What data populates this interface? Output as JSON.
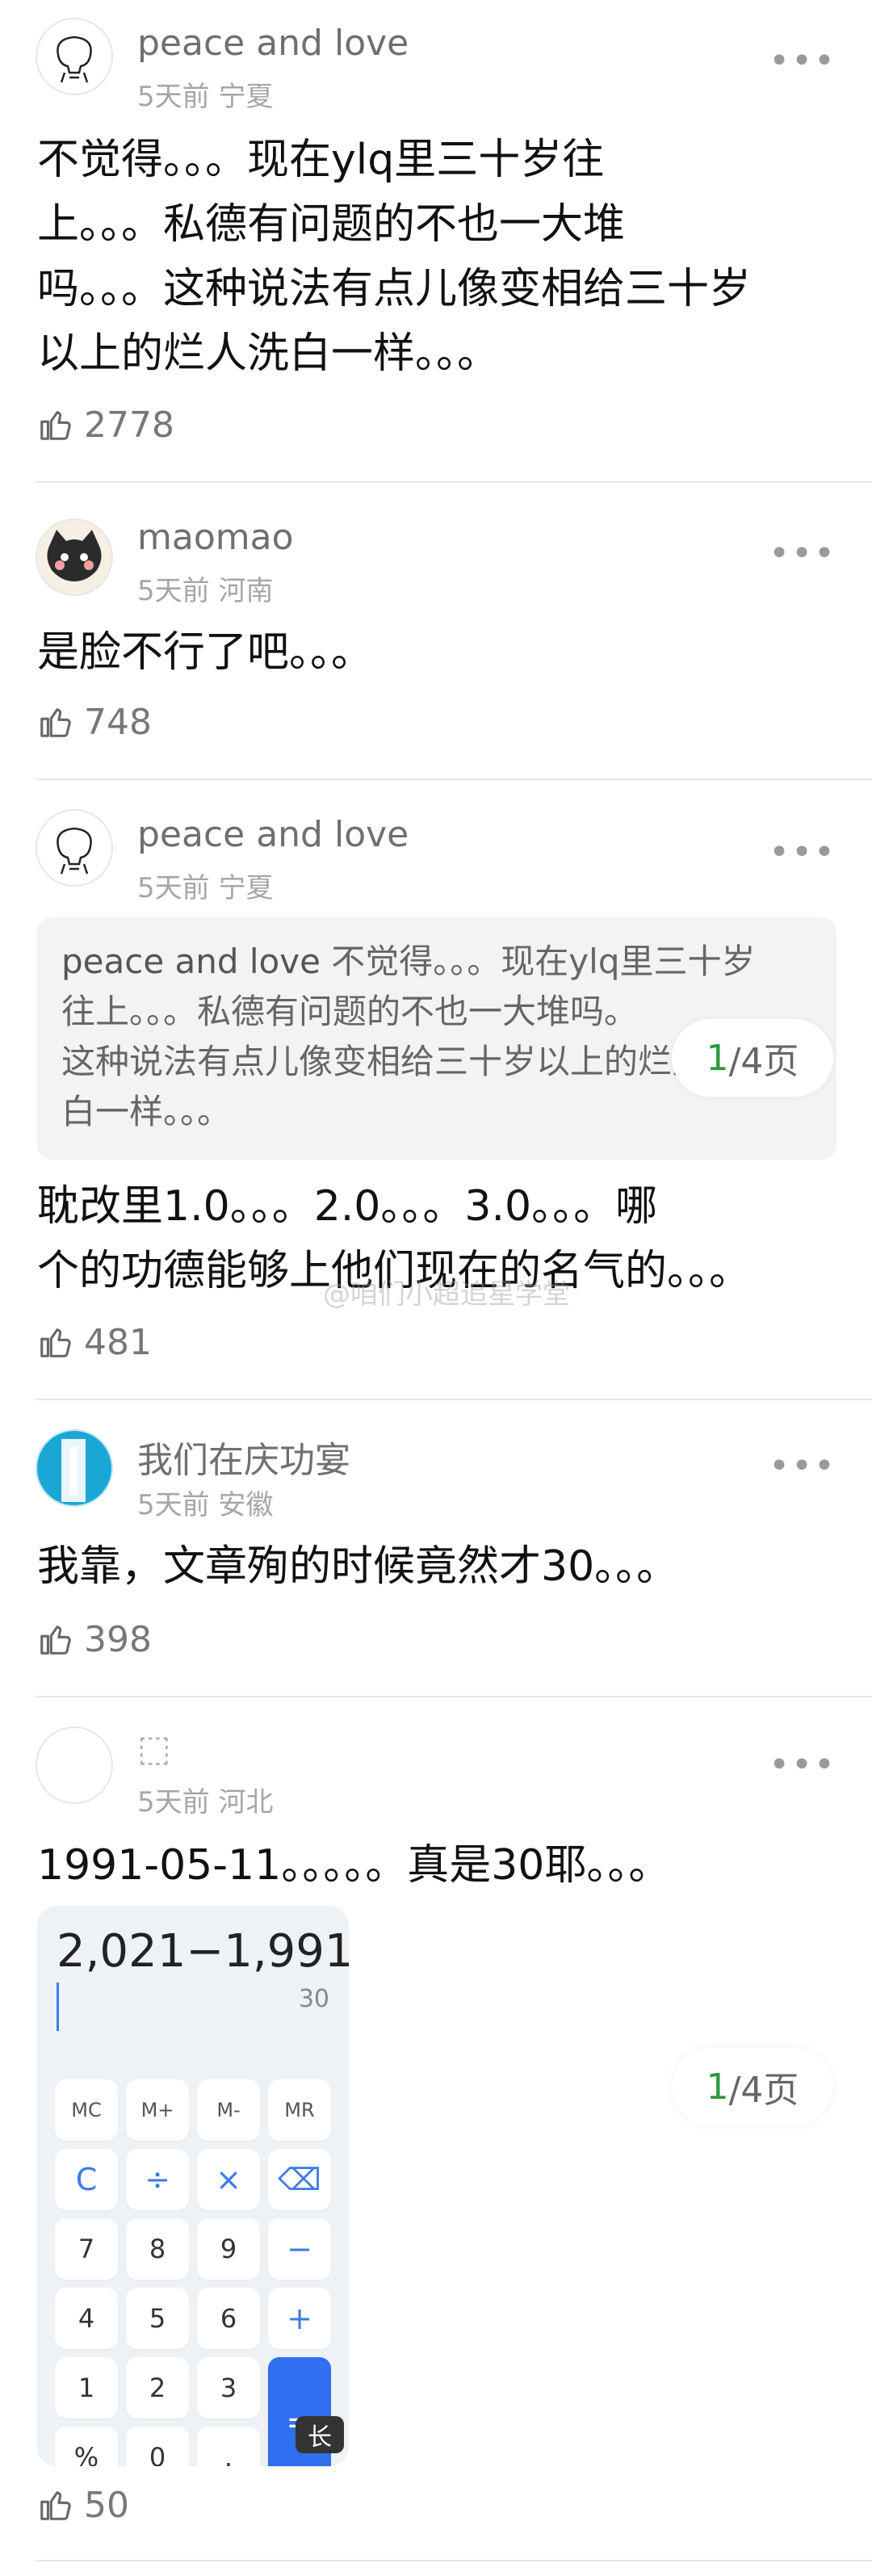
{
  "comments": [
    {
      "user": "peace and love",
      "meta": "5天前 宁夏",
      "more": "•••",
      "lines": [
        "不觉得。。。现在ylq里三十岁往",
        "上。。。私德有问题的不也一大堆",
        "吗。。。这种说法有点儿像变相给三十岁",
        "以上的烂人洗白一样。。。"
      ],
      "likes": "2778"
    },
    {
      "user": "maomao",
      "meta": "5天前 河南",
      "more": "•••",
      "lines": [
        "是脸不行了吧。。。"
      ],
      "likes": "748"
    },
    {
      "user": "peace and love",
      "meta": "5天前 宁夏",
      "more": "•••",
      "quote": {
        "name": "peace and love",
        "lines": [
          " 不觉得。。。现在ylq里三十岁",
          "往上。。。私德有问题的不也一大堆吗。",
          "这种说法有点儿像变相给三十岁以上的烂人洗",
          "白一样。。。"
        ]
      },
      "lines": [
        "耽改里1.0。。。2.0。。。3.0。。。哪",
        "个的功德能够上他们现在的名气的。。。"
      ],
      "likes": "481"
    },
    {
      "user": "我们在庆功宴",
      "meta": "5天前 安徽",
      "more": "•••",
      "lines": [
        "我靠，文章殉的时候竟然才30。。。"
      ],
      "likes": "398"
    },
    {
      "user": "⬚",
      "meta": "5天前 河北",
      "more": "•••",
      "lines": [
        "1991-05-11。。。。。真是30耶。。。"
      ],
      "likes": "50"
    }
  ],
  "pagers": [
    {
      "current": "1",
      "rest": "/4页"
    },
    {
      "current": "1",
      "rest": "/4页"
    }
  ],
  "watermark": "@咱们小超追星学堂",
  "calculator": {
    "expression": "2,021−1,991",
    "result": "30",
    "keys": [
      "MC",
      "M+",
      "M-",
      "MR",
      "C",
      "÷",
      "×",
      "⌫",
      "7",
      "8",
      "9",
      "−",
      "4",
      "5",
      "6",
      "+",
      "1",
      "2",
      "3",
      "=",
      "%",
      "0",
      "."
    ],
    "long_label": "长"
  }
}
